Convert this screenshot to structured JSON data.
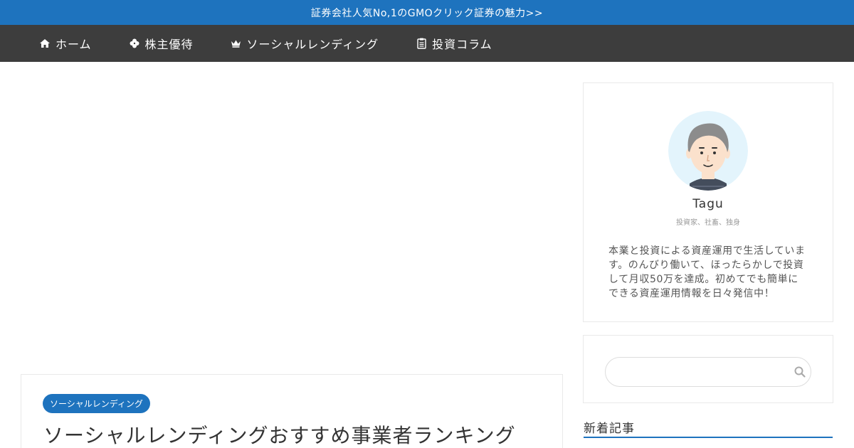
{
  "topbar": {
    "text": "証券会社人気No,1のGMOクリック証券の魅力>>"
  },
  "nav": {
    "items": [
      {
        "label": "ホーム",
        "icon": "home-icon"
      },
      {
        "label": "株主優待",
        "icon": "clover-icon"
      },
      {
        "label": "ソーシャルレンディング",
        "icon": "crown-icon"
      },
      {
        "label": "投資コラム",
        "icon": "clipboard-icon"
      }
    ]
  },
  "article": {
    "category": "ソーシャルレンディング",
    "title": "ソーシャルレンディングおすすめ事業者ランキング"
  },
  "profile": {
    "name": "Tagu",
    "tagline": "投資家、社畜、独身",
    "bio": "本業と投資による資産運用で生活しています。のんびり働いて、ほったらかしで投資して月収50万を達成。初めてでも簡単にできる資産運用情報を日々発信中！"
  },
  "search": {
    "placeholder": ""
  },
  "widgets": {
    "new_posts_heading": "新着記事"
  },
  "colors": {
    "accent": "#1e73be",
    "nav_bg": "#3d3d3d",
    "card_border": "#e9e9e9"
  }
}
